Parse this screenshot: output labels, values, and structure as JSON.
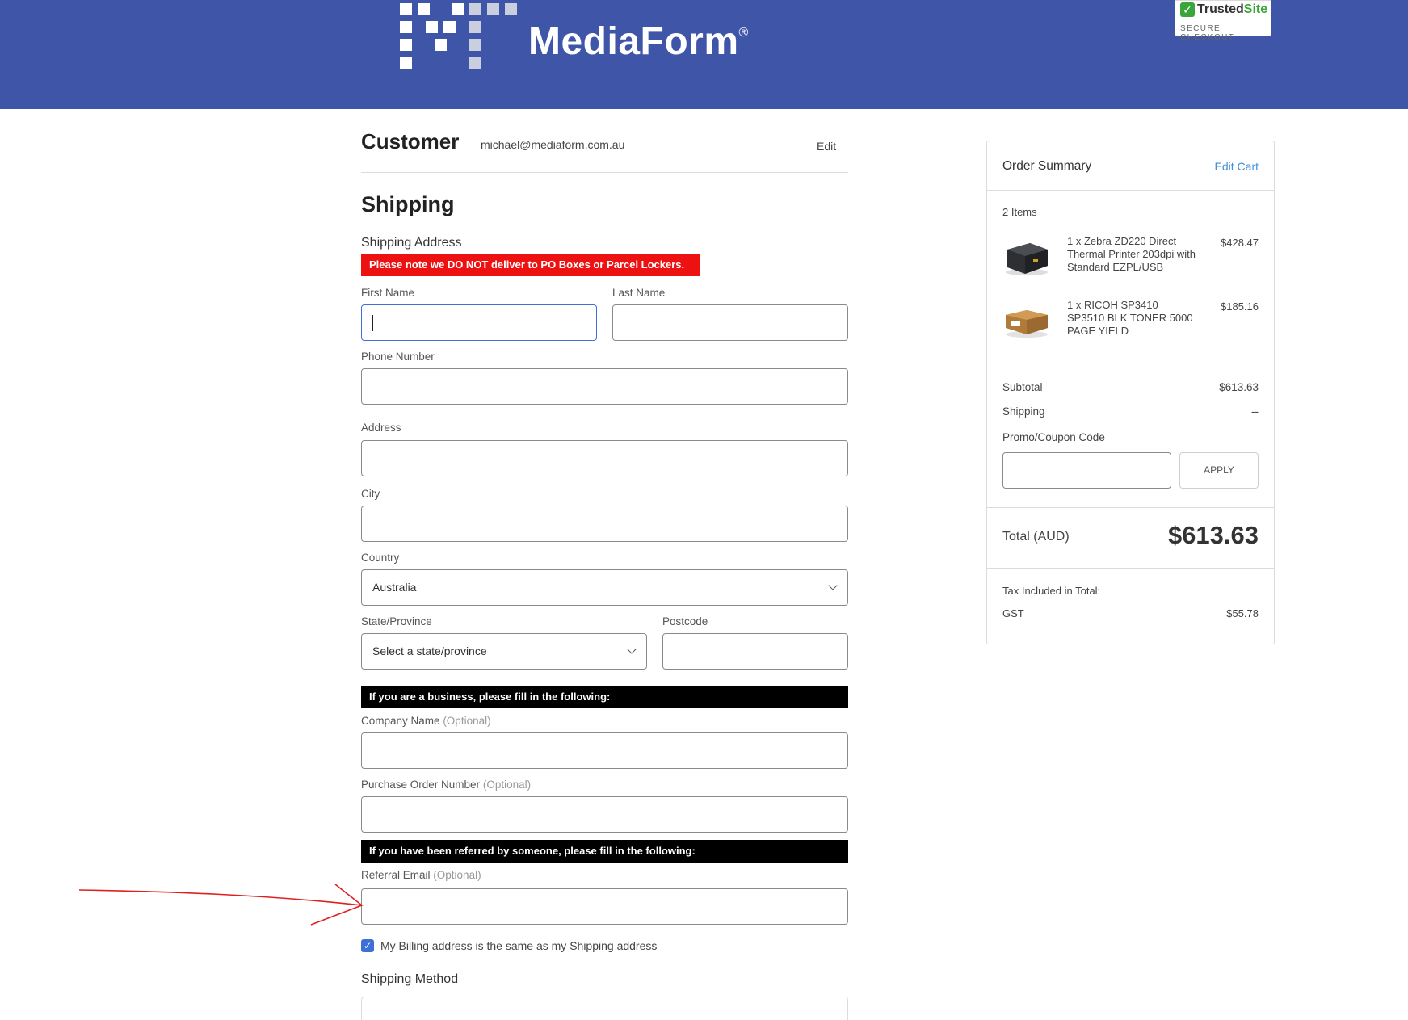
{
  "brand": {
    "name": "MediaForm",
    "registered": "®"
  },
  "trusted_badge": {
    "name_a": "Trusted",
    "name_b": "Site",
    "sub": "SECURE CHECKOUT"
  },
  "customer": {
    "title": "Customer",
    "email": "michael@mediaform.com.au",
    "edit_label": "Edit"
  },
  "shipping": {
    "title": "Shipping",
    "address_heading": "Shipping Address",
    "po_note": "Please note we DO NOT deliver to PO Boxes or Parcel Lockers.",
    "first_name_label": "First Name",
    "last_name_label": "Last Name",
    "phone_label": "Phone Number",
    "address_label": "Address",
    "city_label": "City",
    "country_label": "Country",
    "country_value": "Australia",
    "state_label": "State/Province",
    "state_value": "Select a state/province",
    "postcode_label": "Postcode",
    "business_note": "If you are a business, please fill in the following:",
    "company_label": "Company Name",
    "po_number_label": "Purchase Order Number",
    "optional_text": "(Optional)",
    "referral_note": "If you have been referred by someone, please fill in the following:",
    "referral_label": "Referral Email",
    "billing_same_label": "My Billing address is the same as my Shipping address",
    "billing_same_checked": true,
    "method_title": "Shipping Method"
  },
  "order_summary": {
    "title": "Order Summary",
    "edit_cart_label": "Edit Cart",
    "item_count": "2 Items",
    "items": [
      {
        "name": "1 x Zebra ZD220 Direct Thermal Printer 203dpi with Standard EZPL/USB",
        "price": "$428.47"
      },
      {
        "name": "1 x RICOH SP3410 SP3510 BLK TONER 5000 PAGE YIELD",
        "price": "$185.16"
      }
    ],
    "subtotal_label": "Subtotal",
    "subtotal_value": "$613.63",
    "shipping_label": "Shipping",
    "shipping_value": "--",
    "promo_label": "Promo/Coupon Code",
    "apply_label": "APPLY",
    "total_label": "Total (AUD)",
    "total_value": "$613.63",
    "tax_heading": "Tax Included in Total:",
    "gst_label": "GST",
    "gst_value": "$55.78"
  },
  "colors": {
    "header": "#3f55a8",
    "accent": "#3f6fd8",
    "warning": "#ee1111",
    "annotation": "#e02020"
  }
}
